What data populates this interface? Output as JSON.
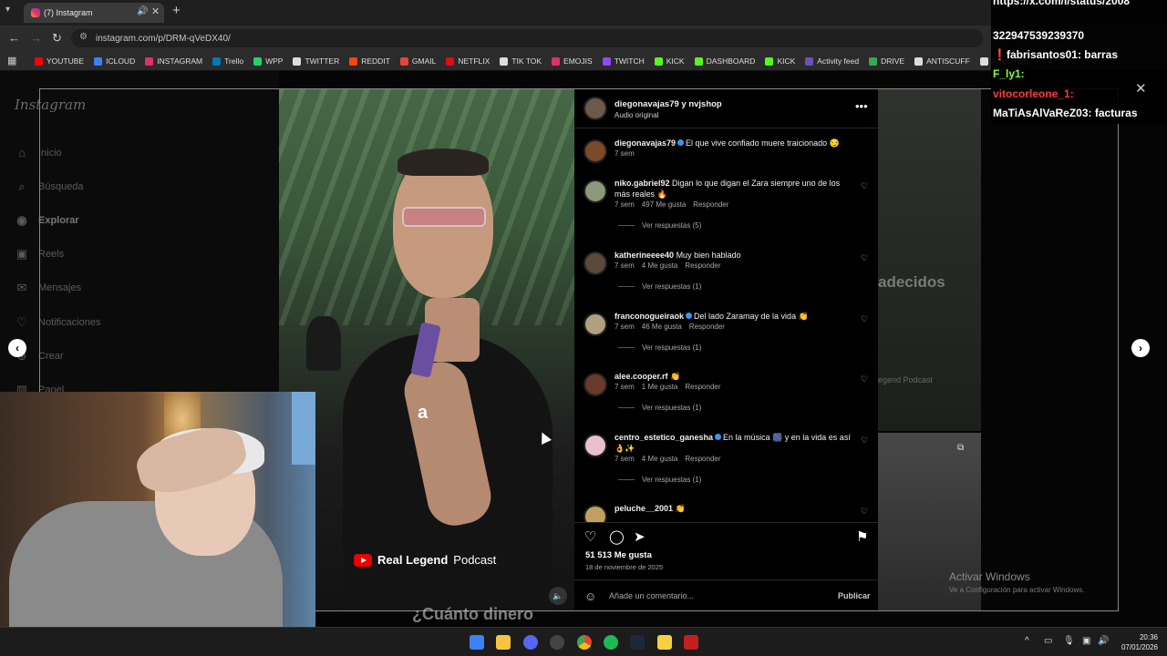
{
  "browser": {
    "tab_title": "(7) Instagram",
    "url": "instagram.com/p/DRM-qVeDX40/",
    "bookmarks": [
      {
        "label": "YOUTUBE",
        "color": "#ff0000"
      },
      {
        "label": "ICLOUD",
        "color": "#3b82f6"
      },
      {
        "label": "INSTAGRAM",
        "color": "#e1306c"
      },
      {
        "label": "Trello",
        "color": "#0079bf"
      },
      {
        "label": "WPP",
        "color": "#25d366"
      },
      {
        "label": "TWITTER",
        "color": "#dddddd"
      },
      {
        "label": "REDDIT",
        "color": "#ff4500"
      },
      {
        "label": "GMAIL",
        "color": "#ea4335"
      },
      {
        "label": "NETFLIX",
        "color": "#e50914"
      },
      {
        "label": "TIK TOK",
        "color": "#dddddd"
      },
      {
        "label": "EMOJIS",
        "color": "#e1306c"
      },
      {
        "label": "TWITCH",
        "color": "#9146ff"
      },
      {
        "label": "KICK",
        "color": "#53fc18"
      },
      {
        "label": "DASHBOARD",
        "color": "#53fc18"
      },
      {
        "label": "KICK",
        "color": "#53fc18"
      },
      {
        "label": "Activity feed",
        "color": "#6b4fbb"
      },
      {
        "label": "DRIVE",
        "color": "#34a853"
      },
      {
        "label": "ANTISCUFF",
        "color": "#dddddd"
      },
      {
        "label": "FUENTES",
        "color": "#dddddd"
      }
    ]
  },
  "sidebar": {
    "logo": "Instagram",
    "items": [
      {
        "label": "Inicio",
        "icon": "home-icon"
      },
      {
        "label": "Búsqueda",
        "icon": "search-icon"
      },
      {
        "label": "Explorar",
        "icon": "compass-icon"
      },
      {
        "label": "Reels",
        "icon": "reels-icon"
      },
      {
        "label": "Mensajes",
        "icon": "messenger-icon"
      },
      {
        "label": "Notificaciones",
        "icon": "heart-icon"
      },
      {
        "label": "Crear",
        "icon": "plus-icon"
      },
      {
        "label": "Panel",
        "icon": "chart-icon"
      }
    ]
  },
  "video": {
    "caption": "a",
    "channel": "Real Legend",
    "channel_suffix": "Podcast",
    "bottom_text": "¿Cuánto dinero"
  },
  "post": {
    "header_user": "diegonavajas79 y nvjshop",
    "audio": "Audio original",
    "likes": "51 513 Me gusta",
    "date": "18 de noviembre de 2025",
    "add_comment_placeholder": "Añade un comentario...",
    "publish_label": "Publicar"
  },
  "comments": [
    {
      "user": "diegonavajas79",
      "text": "El que vive confiado muere traicionado 😏",
      "time": "7 sem",
      "likes": "",
      "reply": "",
      "replies": ""
    },
    {
      "user": "niko.gabriel92",
      "text": "Digan lo que digan el Zara siempre uno de los más reales 🔥",
      "time": "7 sem",
      "likes": "497 Me gusta",
      "reply": "Responder",
      "replies": "Ver respuestas (5)"
    },
    {
      "user": "katherineeee40",
      "text": "Muy bien hablado",
      "time": "7 sem",
      "likes": "4 Me gusta",
      "reply": "Responder",
      "replies": "Ver respuestas (1)"
    },
    {
      "user": "franconogueiraok",
      "text": "Del lado Zaramay de la vida 👏",
      "time": "7 sem",
      "likes": "46 Me gusta",
      "reply": "Responder",
      "replies": "Ver respuestas (1)"
    },
    {
      "user": "alee.cooper.rf",
      "text": "👏",
      "time": "7 sem",
      "likes": "1 Me gusta",
      "reply": "Responder",
      "replies": "Ver respuestas (1)"
    },
    {
      "user": "centro_estetico_ganesha",
      "text": "En la música 🎆 y en la vida es así 👌✨",
      "time": "7 sem",
      "likes": "4 Me gusta",
      "reply": "Responder",
      "replies": "Ver respuestas (1)"
    },
    {
      "user": "peluche__2001",
      "text": "👏",
      "time": "",
      "likes": "",
      "reply": "",
      "replies": ""
    }
  ],
  "right_preview": {
    "text": "adecidos",
    "sub": "egend Podcast"
  },
  "windows_watermark": {
    "title": "Activar Windows",
    "sub": "Ve a Configuración para activar Windows."
  },
  "chat": [
    {
      "text": "https://x.com/i/status/2008",
      "color": "#ffffff"
    },
    {
      "text": "322947539239370",
      "color": "#ffffff"
    },
    {
      "text": "❗fabrisantos01: barras",
      "color": "#ffffff"
    },
    {
      "text": "F_ly1:",
      "color": "#7dff3a"
    },
    {
      "text": "vitocorleone_1:",
      "color": "#ff3a3a"
    },
    {
      "text": "MaTiAsAlVaReZ03: facturas",
      "color": "#ffffff"
    }
  ],
  "clock": {
    "time": "20:36",
    "date": "07/01/2026"
  }
}
